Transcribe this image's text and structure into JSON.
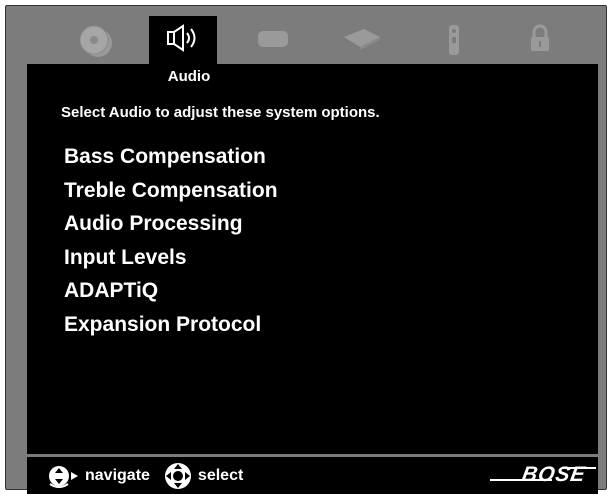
{
  "tabs": [
    {
      "name": "disc",
      "icon": "disc-icon",
      "active": false
    },
    {
      "name": "audio",
      "icon": "speaker-icon",
      "active": true,
      "label": "Audio"
    },
    {
      "name": "video",
      "icon": "screen-icon",
      "active": false
    },
    {
      "name": "network",
      "icon": "device-icon",
      "active": false
    },
    {
      "name": "remote",
      "icon": "remote-icon",
      "active": false
    },
    {
      "name": "lock",
      "icon": "lock-icon",
      "active": false
    }
  ],
  "screen": {
    "subtitle": "Select Audio to adjust these system options.",
    "items": [
      "Bass Compensation",
      "Treble Compensation",
      "Audio Processing",
      "Input Levels",
      "ADAPTiQ",
      "Expansion Protocol"
    ]
  },
  "footer": {
    "navigate_label": "navigate",
    "select_label": "select",
    "brand": "BOSE"
  },
  "colors": {
    "frame": "#7c7c7c",
    "screen": "#000000",
    "inactive_icon": "#9a9a9a",
    "text": "#ffffff"
  }
}
